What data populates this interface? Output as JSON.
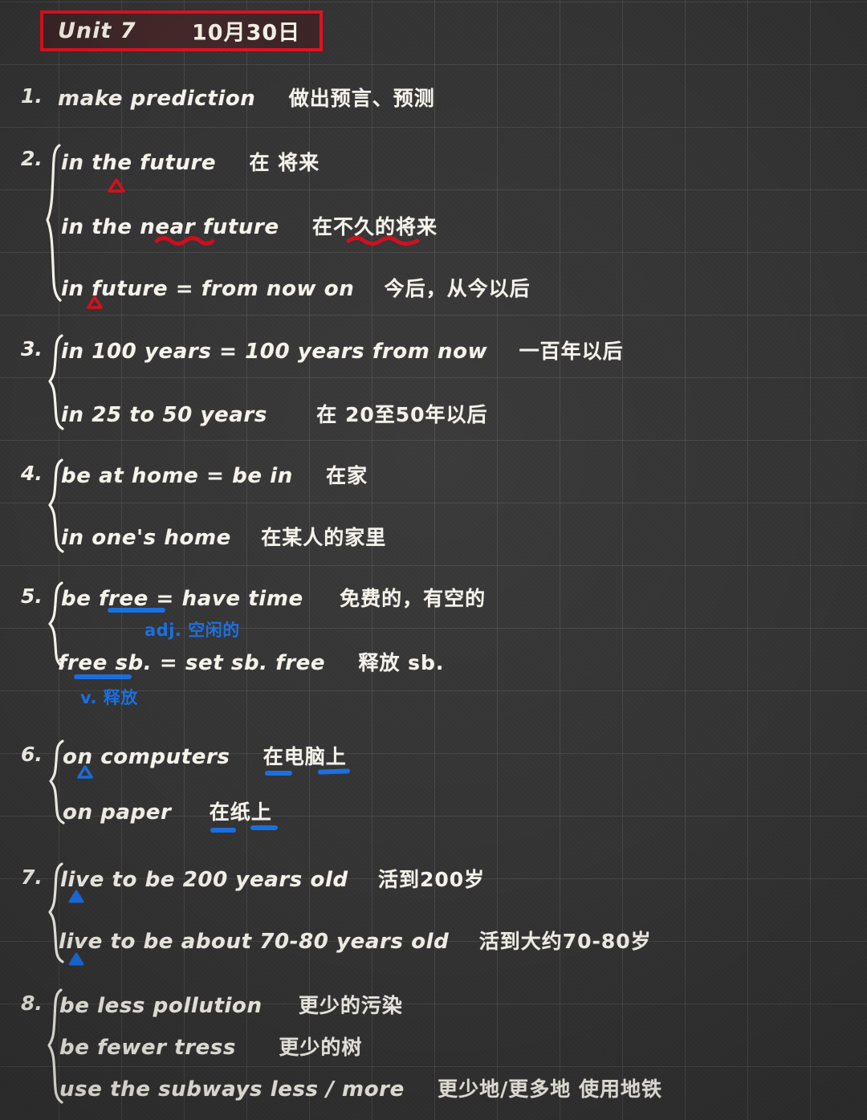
{
  "header": {
    "unit": "Unit 7",
    "date": "10月30日",
    "border_color": "#e01221",
    "fill_color": "#3a2626"
  },
  "palette": {
    "background": "#333333",
    "grid_line": "rgba(255,255,255,0.085)",
    "ink_white": "#f6f3ec",
    "ink_red": "#cc0d1c",
    "ink_blue": "#1a6fe0"
  },
  "notes": [
    {
      "number": "1.",
      "lines": [
        {
          "en": "make  prediction",
          "cn": "做出预言、预测"
        }
      ]
    },
    {
      "number": "2.",
      "lines": [
        {
          "en": "in  the  future",
          "cn": "在 将来"
        },
        {
          "en": "in  the  near  future",
          "cn": "在不久的将来"
        },
        {
          "en": "in  future = from  now  on",
          "cn": "今后，从今以后"
        }
      ]
    },
    {
      "number": "3.",
      "lines": [
        {
          "en": "in  100  years = 100  years  from  now",
          "cn": "一百年以后"
        },
        {
          "en": "in  25  to  50 years",
          "cn": "在 20至50年以后"
        }
      ]
    },
    {
      "number": "4.",
      "lines": [
        {
          "en": "be  at  home  =  be  in",
          "cn": "在家"
        },
        {
          "en": "in  one's  home",
          "cn": "在某人的家里"
        }
      ]
    },
    {
      "number": "5.",
      "lines": [
        {
          "en": "be  free  =  have  time",
          "cn": "免费的，有空的"
        },
        {
          "en": "free  sb.  =  set  sb. free",
          "cn": "释放 sb."
        }
      ],
      "annotations": [
        {
          "text": "adj. 空闲的",
          "color": "#1a6fe0"
        },
        {
          "text": "v. 释放",
          "color": "#1a6fe0"
        }
      ]
    },
    {
      "number": "6.",
      "lines": [
        {
          "en": "on  computers",
          "cn": "在电脑上"
        },
        {
          "en": "on   paper",
          "cn": "在纸上"
        }
      ]
    },
    {
      "number": "7.",
      "lines": [
        {
          "en": "live  to  be  200  years  old",
          "cn": "活到200岁"
        },
        {
          "en": "live  to  be  about  70-80   years  old",
          "cn": "活到大约70-80岁"
        }
      ]
    },
    {
      "number": "8.",
      "lines": [
        {
          "en": "be  less  pollution",
          "cn": "更少的污染"
        },
        {
          "en": "be  fewer  tress",
          "cn": "更少的树"
        },
        {
          "en": "use  the   subways  less / more",
          "cn": "更少地/更多地 使用地铁"
        }
      ]
    }
  ]
}
